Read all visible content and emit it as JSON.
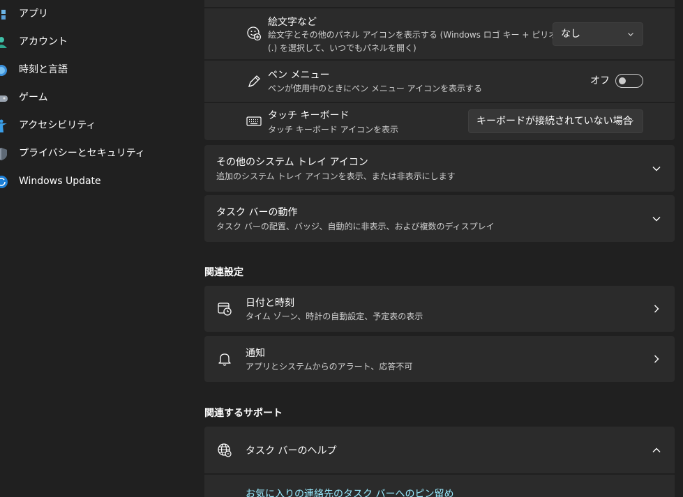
{
  "sidebar": {
    "items": [
      {
        "label": "アプリ",
        "icon": "apps-icon"
      },
      {
        "label": "アカウント",
        "icon": "account-icon"
      },
      {
        "label": "時刻と言語",
        "icon": "time-language-icon"
      },
      {
        "label": "ゲーム",
        "icon": "gaming-icon"
      },
      {
        "label": "アクセシビリティ",
        "icon": "accessibility-icon"
      },
      {
        "label": "プライバシーとセキュリティ",
        "icon": "shield-icon"
      },
      {
        "label": "Windows Update",
        "icon": "windows-update-icon"
      }
    ]
  },
  "pen_section": {
    "emoji": {
      "title": "絵文字など",
      "desc_line1": "絵文字とその他のパネル アイコンを表示する (Windows ロゴ キー + ピリオド",
      "desc_line2": "(.) を選択して、いつでもパネルを開く)",
      "dropdown_value": "なし"
    },
    "pen_menu": {
      "title": "ペン メニュー",
      "desc": "ペンが使用中のときにペン メニュー アイコンを表示する",
      "toggle_label": "オフ",
      "toggle_state": "off"
    },
    "touch_keyboard": {
      "title": "タッチ キーボード",
      "desc": "タッチ キーボード アイコンを表示",
      "dropdown_value": "キーボードが接続されていない場合"
    }
  },
  "other_tray": {
    "title": "その他のシステム トレイ アイコン",
    "desc": "追加のシステム トレイ アイコンを表示、または非表示にします"
  },
  "taskbar_behavior": {
    "title": "タスク バーの動作",
    "desc": "タスク バーの配置、バッジ、自動的に非表示、および複数のディスプレイ"
  },
  "related_settings": {
    "heading": "関連設定",
    "items": [
      {
        "title": "日付と時刻",
        "desc": "タイム ゾーン、時計の自動設定、予定表の表示",
        "icon": "calendar-clock-icon"
      },
      {
        "title": "通知",
        "desc": "アプリとシステムからのアラート、応答不可",
        "icon": "bell-icon"
      }
    ]
  },
  "related_support": {
    "heading": "関連するサポート",
    "help_title": "タスク バーのヘルプ",
    "link": "お気に入りの連絡先のタスク バーへのピン留め"
  },
  "colors": {
    "accent": "#4cc2ff",
    "card": "#2b2b2b",
    "background": "#202020",
    "link": "#99ebff"
  }
}
